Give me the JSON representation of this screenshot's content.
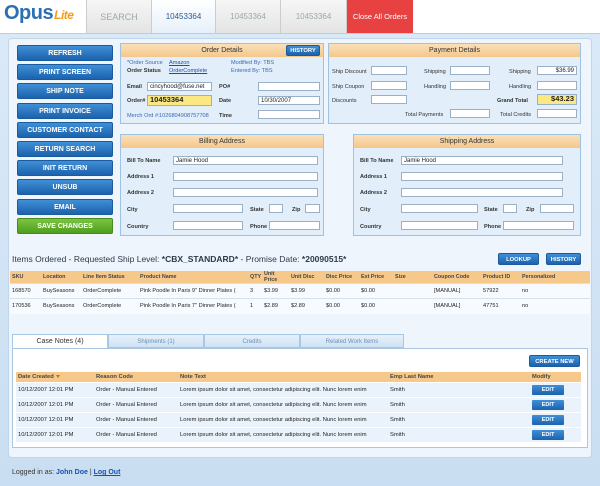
{
  "app": {
    "logo": "Opus",
    "logo_suffix": "Lite"
  },
  "tabs": [
    {
      "label": "SEARCH"
    },
    {
      "label": "10453364"
    },
    {
      "label": "10453364"
    },
    {
      "label": "10453364"
    },
    {
      "label": "Close All Orders"
    }
  ],
  "nav": [
    "REFRESH",
    "PRINT SCREEN",
    "SHIP NOTE",
    "PRINT INVOICE",
    "CUSTOMER CONTACT",
    "RETURN SEARCH",
    "INIT RETURN",
    "UNSUB",
    "EMAIL",
    "SAVE CHANGES"
  ],
  "order": {
    "title": "Order Details",
    "history_btn": "HISTORY",
    "source_label": "*Order Source",
    "source": "Amazon",
    "status_label": "Order Status",
    "status": "OrderComplete",
    "modified_by": "Modified By: TBS",
    "entered_by": "Entered By: TBS",
    "email_label": "Email",
    "email": "cincyhood@fuse.net",
    "po_label": "PO#",
    "order_no_label": "Order#",
    "order_no": "10453364",
    "date_label": "Date",
    "date": "10/30/2007",
    "merch_label": "Merch Ord #:",
    "merch": "1026804908757708",
    "time_label": "Time"
  },
  "payment": {
    "title": "Payment Details",
    "ship_discount": "Ship Discount",
    "shipping_mid": "Shipping",
    "shipping": "Shipping",
    "shipping_value": "$36.99",
    "ship_coupon": "Ship Coupon",
    "handling_mid": "Handling",
    "handling": "Handling",
    "discounts": "Discounts",
    "grand_total": "Grand Total",
    "grand_total_value": "$43.23",
    "total_payments": "Total Payments",
    "total_credits": "Total Credits"
  },
  "billing": {
    "title": "Billing Address",
    "bill_to": "Bill To Name",
    "bill_to_value": "Jamie Hood",
    "addr1": "Address 1",
    "addr2": "Address 2",
    "city": "City",
    "state": "State",
    "zip": "Zip",
    "country": "Country",
    "phone": "Phone"
  },
  "shipping": {
    "title": "Shipping Address",
    "bill_to": "Bill To Name",
    "bill_to_value": "Jamie Hood",
    "addr1": "Address 1",
    "addr2": "Address 2",
    "city": "City",
    "state": "State",
    "zip": "Zip",
    "country": "Country",
    "phone": "Phone"
  },
  "items": {
    "heading_prefix": "Items Ordered - Requested Ship Level: ",
    "ship_level": "*CBX_STANDARD*",
    "heading_mid": " - Promise Date: ",
    "promise_date": "*20090515*",
    "lookup_btn": "LOOKUP",
    "history_btn": "HISTORY",
    "columns": [
      "SKU",
      "Location",
      "Line Item Status",
      "Product Name",
      "QTY",
      "Unit Price",
      "Unit Disc",
      "Disc Price",
      "Ext Price",
      "Size",
      "Coupon Code",
      "Product ID",
      "Personalized"
    ],
    "rows": [
      [
        "168570",
        "BuySeasons",
        "OrderComplete",
        "Pink Poodle In Paris 9\" Dinner Plates (",
        "3",
        "$3.99",
        "$3.99",
        "$0.00",
        "$0.00",
        "",
        "[MANUAL]",
        "57922",
        "no"
      ],
      [
        "170536",
        "BuySeasons",
        "OrderComplete",
        "Pink Poodle In Paris 7\" Dinner Plates (",
        "1",
        "$2.89",
        "$2.89",
        "$0.00",
        "$0.00",
        "",
        "[MANUAL]",
        "47751",
        "no"
      ]
    ]
  },
  "notes_tabs": [
    "Case Notes (4)",
    "Shipments (1)",
    "Credits",
    "Related Work Items"
  ],
  "notes": {
    "create_btn": "CREATE NEW",
    "columns": [
      "Date Created",
      "Reason Code",
      "Note Text",
      "Emp Last Name",
      "Modify"
    ],
    "edit_label": "EDIT",
    "rows": [
      [
        "10/12/2007 12:01 PM",
        "Order - Manual Entered",
        "Lorem ipsum dolor sit amet, consectetur adipiscing elit. Nunc lorem enim",
        "Smith"
      ],
      [
        "10/12/2007 12:01 PM",
        "Order - Manual Entered",
        "Lorem ipsum dolor sit amet, consectetur adipiscing elit. Nunc lorem enim",
        "Smith"
      ],
      [
        "10/12/2007 12:01 PM",
        "Order - Manual Entered",
        "Lorem ipsum dolor sit amet, consectetur adipiscing elit. Nunc lorem enim",
        "Smith"
      ],
      [
        "10/12/2007 12:01 PM",
        "Order - Manual Entered",
        "Lorem ipsum dolor sit amet, consectetur adipiscing elit. Nunc lorem enim",
        "Smith"
      ]
    ]
  },
  "footer": {
    "prefix": "Logged in as: ",
    "user": "John Doe",
    "sep": " | ",
    "logout": "Log Out"
  }
}
